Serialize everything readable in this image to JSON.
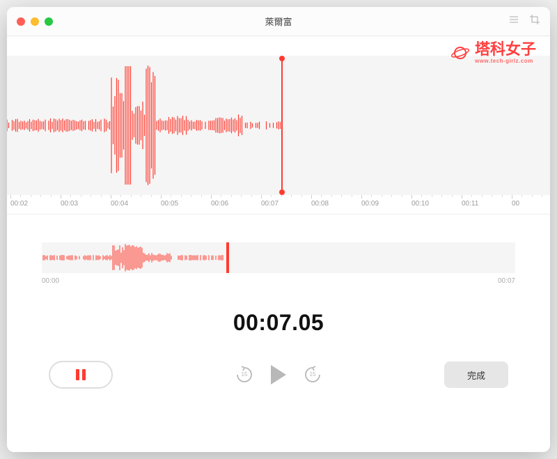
{
  "window": {
    "title": "萊爾富"
  },
  "watermark": {
    "main": "塔科女子",
    "sub": "www.tech-girlz.com"
  },
  "ruler": {
    "ticks": [
      "00:02",
      "00:03",
      "00:04",
      "00:05",
      "00:06",
      "00:07",
      "00:08",
      "00:09",
      "00:10",
      "00:11",
      "00"
    ]
  },
  "minimap": {
    "start": "00:00",
    "end": "00:07"
  },
  "timer": "00:07.05",
  "controls": {
    "skip_back": "15",
    "skip_fwd": "15",
    "done": "完成"
  },
  "playback": {
    "position_pct": 50.5,
    "minimap_pct": 39
  },
  "colors": {
    "accent": "#ff3b30",
    "wave_bg": "#f5f5f5"
  }
}
